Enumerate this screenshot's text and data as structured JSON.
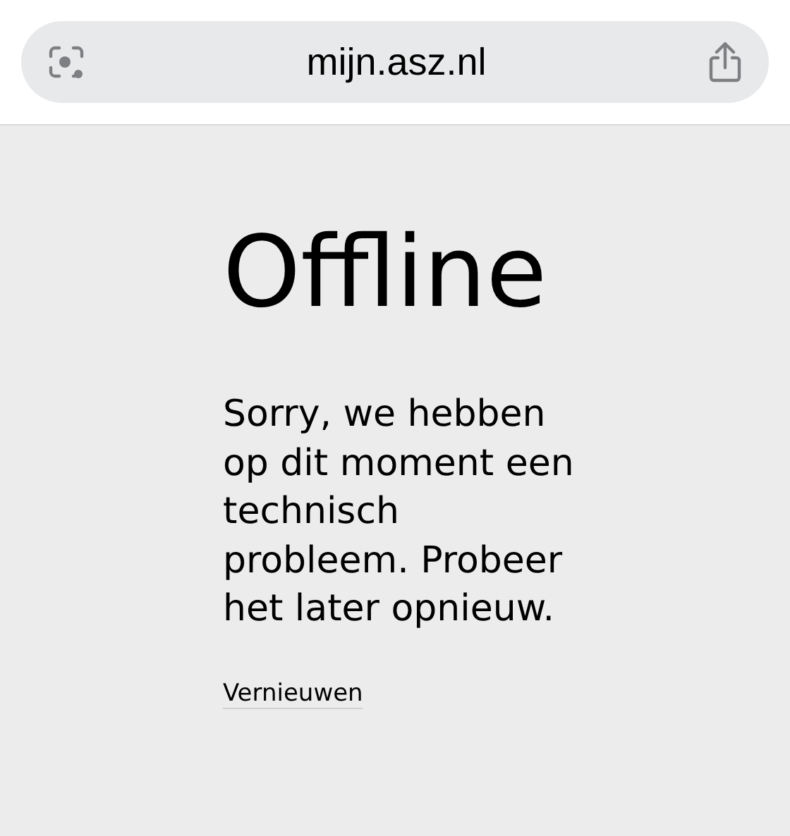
{
  "address_bar": {
    "url": "mijn.asz.nl"
  },
  "page": {
    "title": "Offline",
    "message": "Sorry, we hebben op dit moment een technisch probleem. Probeer het later opnieuw.",
    "link": "Vernieuwen"
  }
}
